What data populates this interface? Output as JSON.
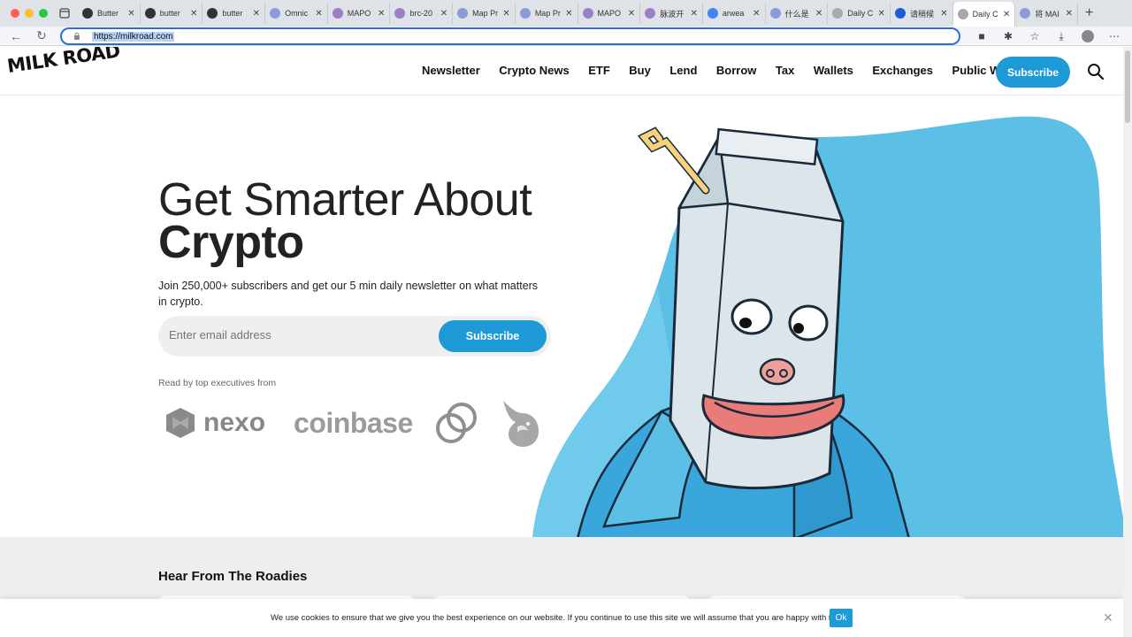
{
  "browser": {
    "tabs": [
      {
        "label": "Butter",
        "icon": "github-icon"
      },
      {
        "label": "butter",
        "icon": "github-icon"
      },
      {
        "label": "butter",
        "icon": "github-icon"
      },
      {
        "label": "Omnic",
        "icon": "triangle-icon"
      },
      {
        "label": "MAPO",
        "icon": "map-icon"
      },
      {
        "label": "brc-20",
        "icon": "map-icon"
      },
      {
        "label": "Map Pr",
        "icon": "triangle-icon"
      },
      {
        "label": "Map Pr",
        "icon": "triangle-icon"
      },
      {
        "label": "MAPO",
        "icon": "map-icon"
      },
      {
        "label": "脉波开",
        "icon": "map-icon"
      },
      {
        "label": "arwea",
        "icon": "google-icon"
      },
      {
        "label": "什么是",
        "icon": "triangle-icon"
      },
      {
        "label": "Daily C",
        "icon": "page-icon"
      },
      {
        "label": "请稍候",
        "icon": "c-icon"
      },
      {
        "label": "Daily C",
        "icon": "page-icon",
        "active": true
      },
      {
        "label": "将 MAI",
        "icon": "triangle-icon"
      }
    ],
    "url": "https://milkroad.com"
  },
  "header": {
    "logo": "MILK ROAD",
    "nav": [
      "Newsletter",
      "Crypto News",
      "ETF",
      "Buy",
      "Lend",
      "Borrow",
      "Tax",
      "Wallets",
      "Exchanges",
      "Public Wallet"
    ],
    "subscribe_label": "Subscribe"
  },
  "hero": {
    "title_line1": "Get Smarter About",
    "title_line2": "Crypto",
    "subtitle": "Join 250,000+ subscribers and get our 5 min daily newsletter on what matters in crypto.",
    "email_placeholder": "Enter email address",
    "subscribe_label": "Subscribe",
    "read_by": "Read by top executives from",
    "brands": {
      "nexo": "nexo",
      "coinbase": "coinbase"
    }
  },
  "roadies": {
    "heading": "Hear From The Roadies"
  },
  "cookie": {
    "text": "We use cookies to ensure that we give you the best experience on our website. If you continue to use this site we will assume that you are happy with it.",
    "ok_label": "Ok"
  },
  "colors": {
    "accent": "#1e9ad6",
    "blob": "#5bbfe6",
    "gray_bg": "#eeeeee"
  }
}
